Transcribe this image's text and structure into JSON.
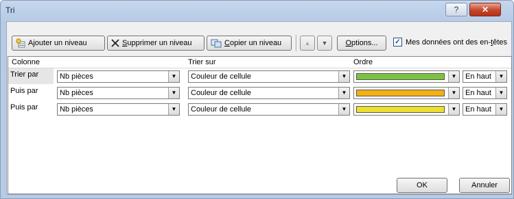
{
  "window": {
    "title": "Tri",
    "help_label": "?",
    "close_label": "✕"
  },
  "toolbar": {
    "add_level": {
      "prefix": "A",
      "underlined": "j",
      "rest": "outer un niveau"
    },
    "delete_level": {
      "underlined": "S",
      "rest": "upprimer un niveau"
    },
    "copy_level": {
      "underlined": "C",
      "rest": "opier un niveau"
    },
    "move_up_label": "▲",
    "move_down_label": "▼",
    "options": {
      "underlined": "O",
      "rest": "ptions..."
    },
    "headers_checkbox": {
      "checked": true,
      "check_mark": "✓",
      "prefix": "Mes données ont des en-",
      "underlined": "t",
      "rest": "êtes"
    }
  },
  "grid": {
    "headers": {
      "column": "Colonne",
      "sort_on": "Trier sur",
      "order": "Ordre"
    },
    "rows": [
      {
        "label": "Trier par",
        "column": "Nb pièces",
        "sort_on": "Couleur de cellule",
        "color": "#7cc242",
        "position": "En haut",
        "selected": true
      },
      {
        "label": "Puis par",
        "column": "Nb pièces",
        "sort_on": "Couleur de cellule",
        "color": "#f2b014",
        "position": "En haut",
        "selected": false
      },
      {
        "label": "Puis par",
        "column": "Nb pièces",
        "sort_on": "Couleur de cellule",
        "color": "#ecdf2f",
        "position": "En haut",
        "selected": false
      }
    ]
  },
  "footer": {
    "ok_label": "OK",
    "cancel_label": "Annuler"
  }
}
